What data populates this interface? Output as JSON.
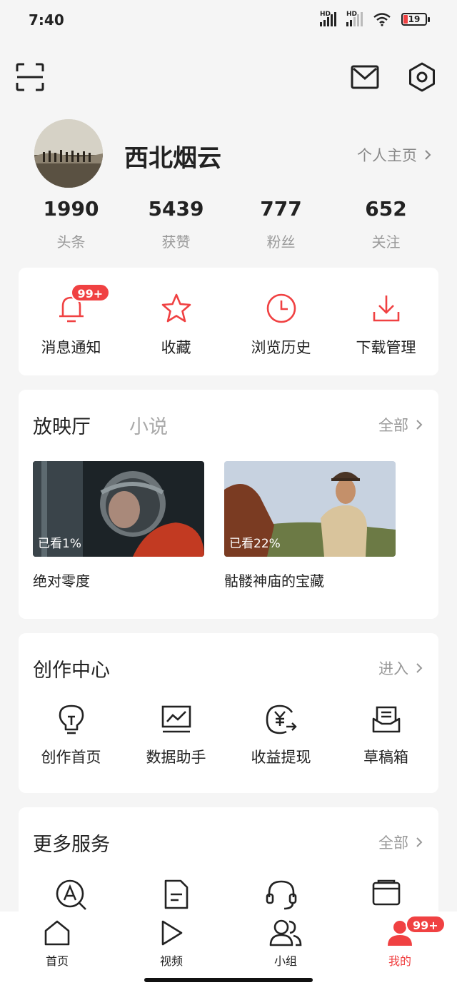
{
  "status_bar": {
    "time": "7:40",
    "battery": "19",
    "network1": "HD",
    "network2": "HD"
  },
  "profile": {
    "username": "西北烟云",
    "homepage_label": "个人主页"
  },
  "stats": [
    {
      "value": "1990",
      "label": "头条"
    },
    {
      "value": "5439",
      "label": "获赞"
    },
    {
      "value": "777",
      "label": "粉丝"
    },
    {
      "value": "652",
      "label": "关注"
    }
  ],
  "quick_actions": [
    {
      "label": "消息通知",
      "icon": "bell-icon",
      "badge": "99+"
    },
    {
      "label": "收藏",
      "icon": "star-icon"
    },
    {
      "label": "浏览历史",
      "icon": "clock-icon"
    },
    {
      "label": "下载管理",
      "icon": "download-icon"
    }
  ],
  "screening": {
    "tabs": [
      "放映厅",
      "小说"
    ],
    "more_label": "全部",
    "videos": [
      {
        "title": "绝对零度",
        "progress_label": "已看1%"
      },
      {
        "title": "骷髅神庙的宝藏",
        "progress_label": "已看22%"
      }
    ]
  },
  "creator": {
    "title": "创作中心",
    "more_label": "进入",
    "items": [
      {
        "label": "创作首页",
        "icon": "lightbulb-icon"
      },
      {
        "label": "数据助手",
        "icon": "chart-icon"
      },
      {
        "label": "收益提现",
        "icon": "yuan-withdraw-icon"
      },
      {
        "label": "草稿箱",
        "icon": "drafts-icon"
      }
    ]
  },
  "services": {
    "title": "更多服务",
    "more_label": "全部"
  },
  "bottom_nav": [
    {
      "label": "首页",
      "icon": "home-icon"
    },
    {
      "label": "视频",
      "icon": "play-icon"
    },
    {
      "label": "小组",
      "icon": "group-icon"
    },
    {
      "label": "我的",
      "icon": "profile-icon",
      "badge": "99+",
      "active": true
    }
  ],
  "colors": {
    "accent": "#f04142",
    "background": "#f5f5f5"
  }
}
